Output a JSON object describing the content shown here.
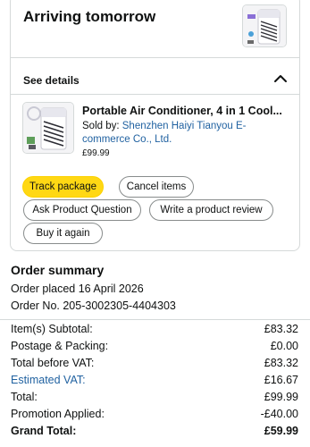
{
  "delivery": {
    "status": "Arriving tomorrow",
    "see_details": "See details"
  },
  "product": {
    "title": "Portable Air Conditioner, 4 in 1 Cool...",
    "sold_by_prefix": "Sold by: ",
    "seller": "Shenzhen Haiyi Tianyou E-commerce Co., Ltd.",
    "price": "£99.99"
  },
  "actions": {
    "track": "Track package",
    "cancel": "Cancel items",
    "question": "Ask Product Question",
    "review": "Write a product review",
    "buy_again": "Buy it again"
  },
  "summary": {
    "title": "Order summary",
    "placed": "Order placed 16 April 2026",
    "order_no": "Order No. 205-3002305-4404303",
    "rows": [
      {
        "label": "Item(s) Subtotal:",
        "value": "£83.32"
      },
      {
        "label": "Postage & Packing:",
        "value": "£0.00"
      },
      {
        "label": "Total before VAT:",
        "value": "£83.32"
      },
      {
        "label": "Estimated VAT:",
        "value": "£16.67"
      },
      {
        "label": "Total:",
        "value": "£99.99"
      },
      {
        "label": "Promotion Applied:",
        "value": "-£40.00"
      },
      {
        "label": "Grand Total:",
        "value": "£59.99"
      }
    ]
  },
  "colors": {
    "link": "#2162a1",
    "primary_button": "#ffd814",
    "border": "#d5d9d9"
  }
}
